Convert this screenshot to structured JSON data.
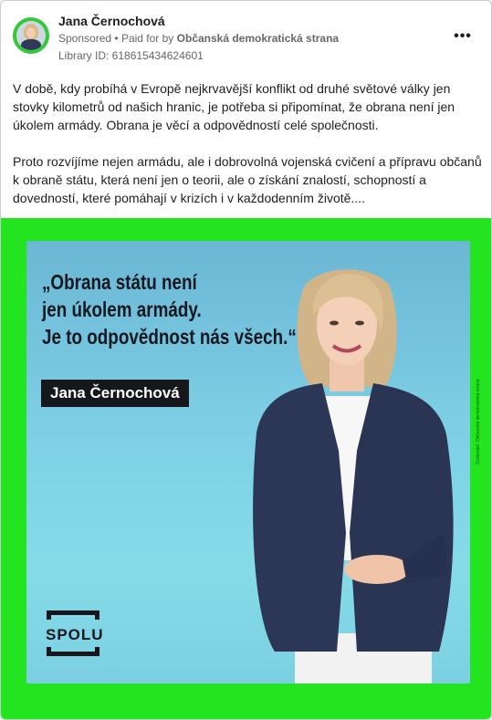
{
  "post": {
    "page_name": "Jana Černochová",
    "sponsored_label": "Sponsored",
    "paid_for_prefix": "Paid for by",
    "payer": "Občanská demokratická strana",
    "library_id": "Library ID: 618615434624601",
    "more_icon": "more-dots-icon",
    "more_label": "•••"
  },
  "body": {
    "paragraph_1": "V době, kdy probíhá v Evropě nejkrvavější konflikt od druhé světové války jen stovky kilometrů od našich hranic, je potřeba si připomínat, že obrana není jen úkolem armády. Obrana je věcí a odpovědností celé společnosti.",
    "paragraph_2": "Proto rozvíjíme nejen armádu, ale i dobrovolná vojenská cvičení a přípravu občanů k obraně státu, která není jen o teorii, ale o získání znalostí, schopností a dovedností, které pomáhají v krizích i v každodenním životě...."
  },
  "creative": {
    "quote_line_1": "„Obrana státu není",
    "quote_line_2": "jen úkolem armády.",
    "quote_line_3": "Je to odpovědnost nás všech.“",
    "name_plate": "Jana Černochová",
    "logo_text": "SPOLU",
    "side_text": "Zadavatel: Občanská demokratická strana",
    "frame_color": "#22e51f",
    "background_color": "#7fd0e6"
  }
}
